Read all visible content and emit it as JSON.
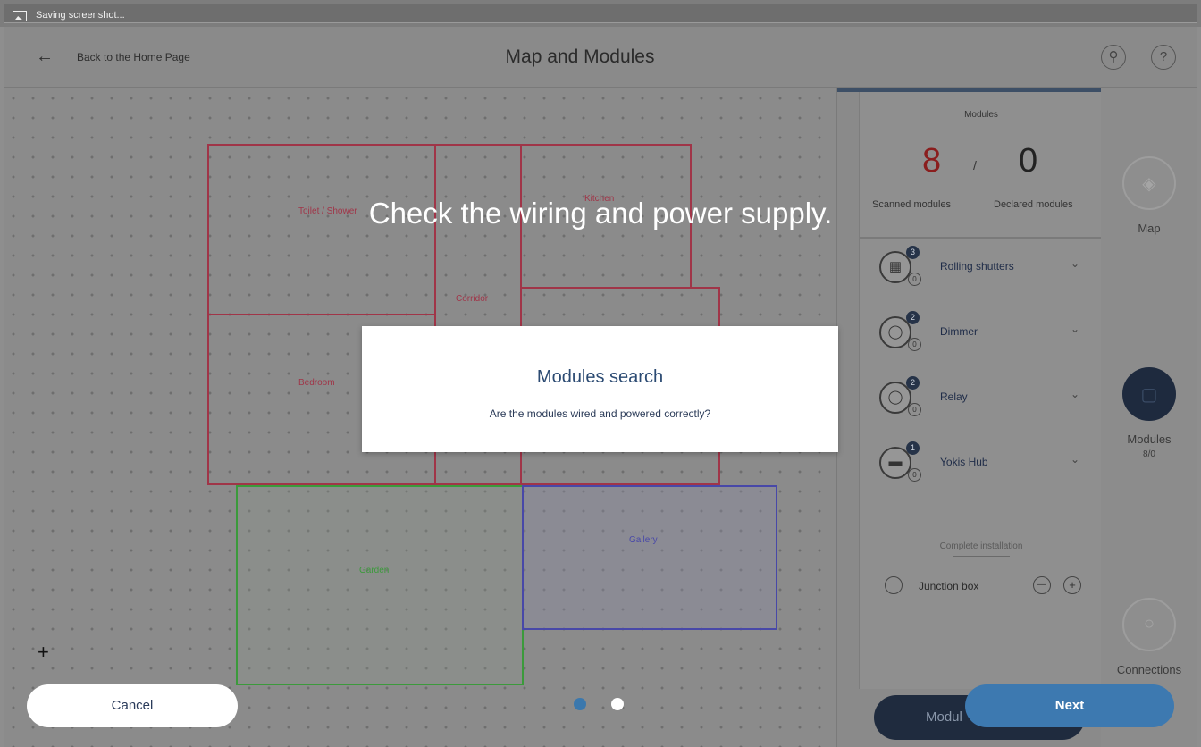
{
  "system": {
    "saving_text": "Saving screenshot..."
  },
  "header": {
    "back_label": "Back to the Home Page",
    "title": "Map and Modules"
  },
  "map": {
    "rooms": [
      {
        "label": "Toilet / Shower"
      },
      {
        "label": "Bedroom"
      },
      {
        "label": "Corridor"
      },
      {
        "label": "Kitchen"
      },
      {
        "label": "Garden"
      },
      {
        "label": "Gallery"
      }
    ]
  },
  "panel": {
    "header": "Modules",
    "scanned_count": "8",
    "separator": "/",
    "declared_count": "0",
    "scanned_label": "Scanned modules",
    "declared_label": "Declared modules",
    "modules": [
      {
        "name": "Rolling shutters",
        "badge": "3",
        "sub": "0",
        "icon": "rolling-shutter-icon"
      },
      {
        "name": "Dimmer",
        "badge": "2",
        "sub": "0",
        "icon": "dimmer-bulb-icon"
      },
      {
        "name": "Relay",
        "badge": "2",
        "sub": "0",
        "icon": "relay-bulb-icon"
      },
      {
        "name": "Yokis Hub",
        "badge": "1",
        "sub": "0",
        "icon": "hub-icon"
      }
    ],
    "complete_label": "Complete installation",
    "junction_box_label": "Junction box"
  },
  "sidenav": {
    "map_label": "Map",
    "modules_label": "Modules",
    "modules_sub": "8/0",
    "connections_label": "Connections"
  },
  "buttons": {
    "cancel": "Cancel",
    "next": "Next",
    "modules_under": "Modul"
  },
  "overlay": {
    "hint": "Check the wiring and power supply.",
    "dialog_title": "Modules search",
    "dialog_message": "Are the modules wired and powered correctly?"
  },
  "pager": {
    "current": 1,
    "total": 2
  },
  "colors": {
    "accent": "#3d79b0",
    "dialog_title": "#2b4a72",
    "scanned_count": "#8a1e1e"
  }
}
